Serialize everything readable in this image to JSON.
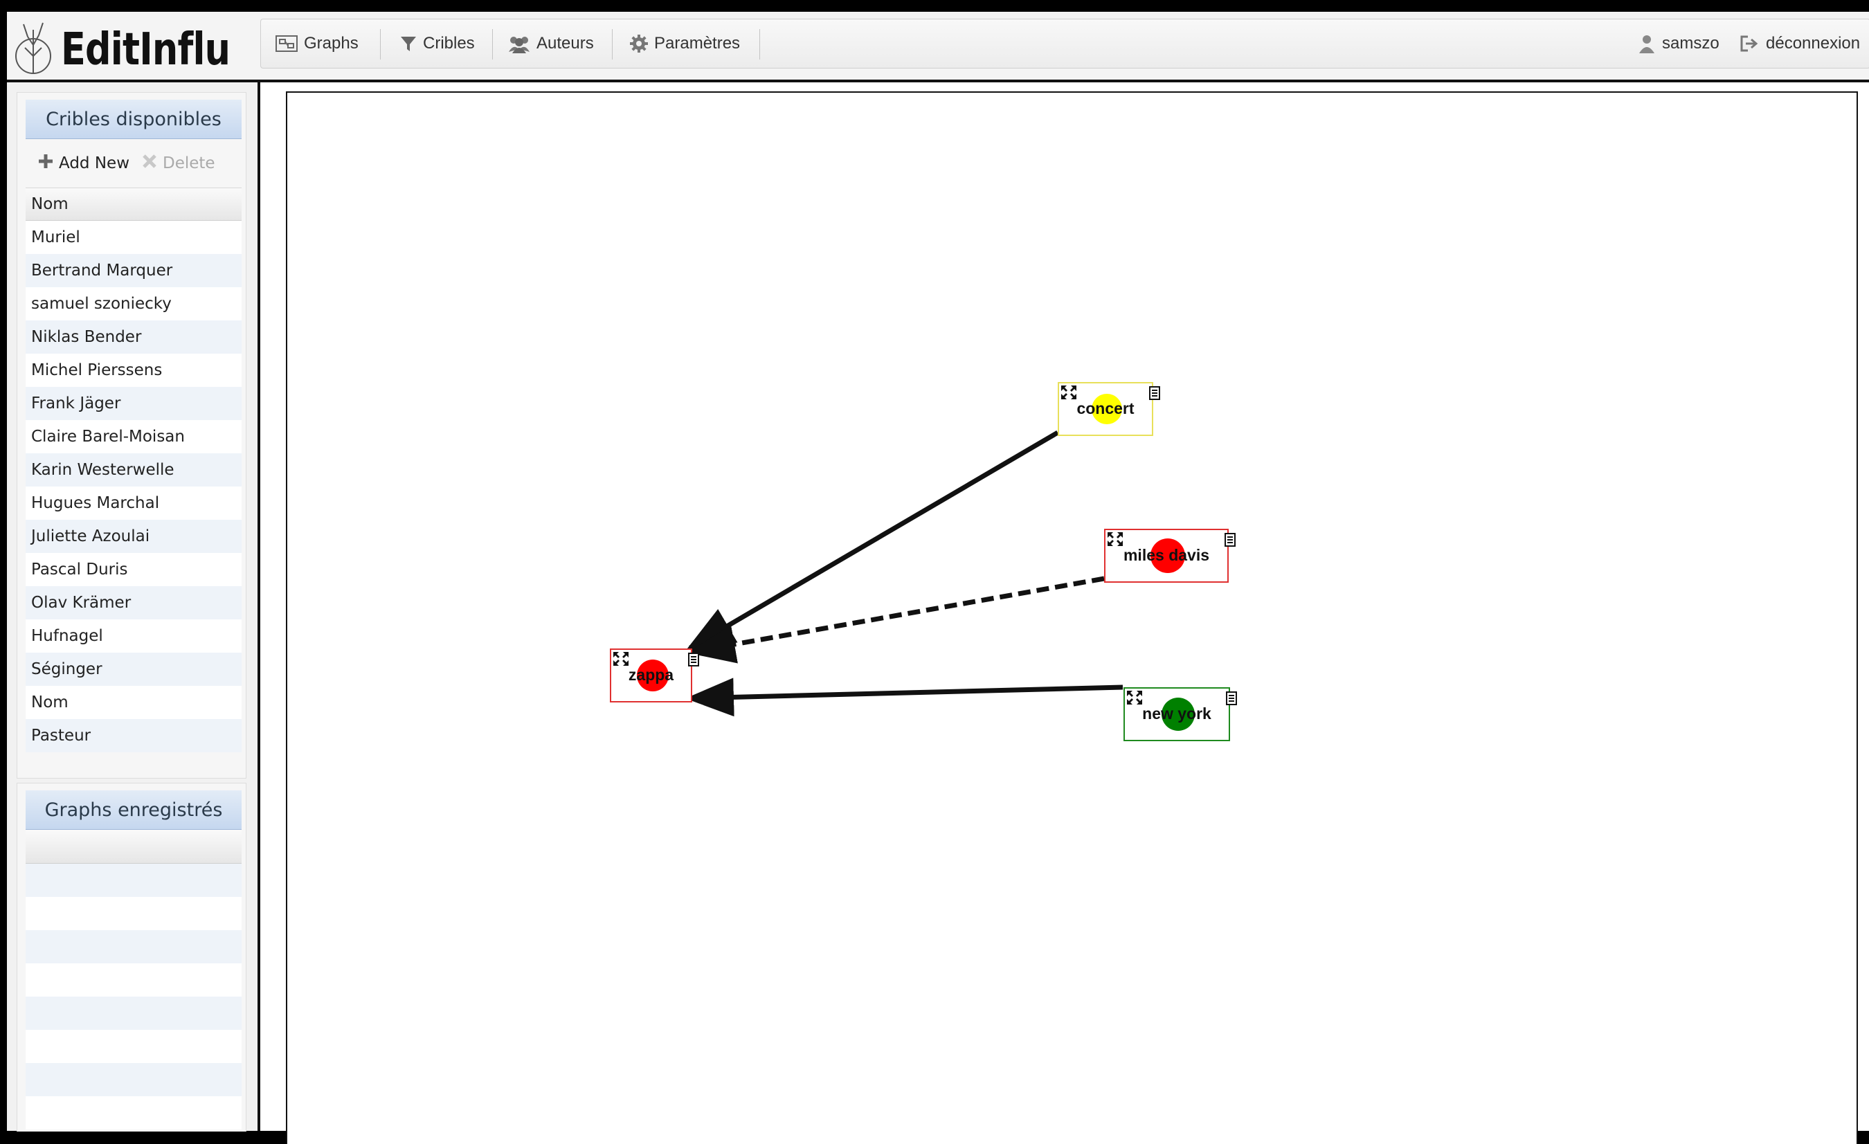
{
  "app": {
    "logo_text": "EditInflu"
  },
  "menu": {
    "graphs": "Graphs",
    "cribles": "Cribles",
    "auteurs": "Auteurs",
    "parametres": "Paramètres",
    "user": "samszo",
    "logout": "déconnexion"
  },
  "sidebar": {
    "cribles_title": "Cribles disponibles",
    "add_new": "Add New",
    "delete": "Delete",
    "column_header": "Nom",
    "items": [
      "Muriel",
      "Bertrand Marquer",
      "samuel szoniecky",
      "Niklas Bender",
      "Michel Pierssens",
      "Frank Jäger",
      "Claire Barel-Moisan",
      "Karin Westerwelle",
      "Hugues Marchal",
      "Juliette Azoulai",
      "Pascal Duris",
      "Olav Krämer",
      "Hufnagel",
      "Séginger",
      "Nom",
      "Pasteur"
    ],
    "graphs_title": "Graphs enregistrés"
  },
  "graph": {
    "nodes": [
      {
        "id": "concert",
        "label": "concert",
        "color": "#ffff00",
        "border": "#e8e05a"
      },
      {
        "id": "miles",
        "label": "miles davis",
        "color": "#ff0000",
        "border": "#e03030"
      },
      {
        "id": "zappa",
        "label": "zappa",
        "color": "#ff0000",
        "border": "#e03030"
      },
      {
        "id": "newyork",
        "label": "new york",
        "color": "#008000",
        "border": "#1f8a1f"
      }
    ],
    "edges": [
      {
        "from": "concert",
        "to": "zappa",
        "style": "solid"
      },
      {
        "from": "miles",
        "to": "zappa",
        "style": "dashed"
      },
      {
        "from": "newyork",
        "to": "zappa",
        "style": "solid"
      }
    ]
  },
  "colors": {
    "panel_header_blue": "#c5d7ef",
    "row_alt": "#eef3f9"
  }
}
